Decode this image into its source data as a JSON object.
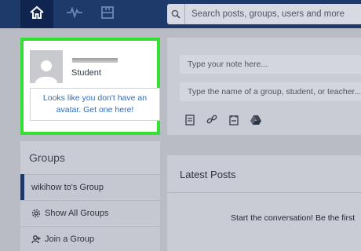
{
  "nav": {
    "search_placeholder": "Search posts, groups, users and more",
    "icons": [
      "home-icon",
      "activity-icon",
      "planner-icon",
      "search-icon"
    ]
  },
  "profile": {
    "role": "Student",
    "avatar_prompt": "Looks like you don't have an avatar. Get one here!"
  },
  "composer": {
    "note_placeholder": "Type your note here...",
    "recipient_placeholder": "Type the name of a group, student, or teacher..."
  },
  "groups": {
    "title": "Groups",
    "items": [
      {
        "label": "wikihow to's Group",
        "icon": ""
      },
      {
        "label": "Show All Groups",
        "icon": "gear-icon"
      },
      {
        "label": "Join a Group",
        "icon": "join-icon"
      }
    ]
  },
  "feed": {
    "title": "Latest Posts",
    "empty_message": "Start the conversation! Be the first"
  },
  "colors": {
    "topbar": "#1e3a6b",
    "highlight": "#35e035",
    "link": "#2d6cc0"
  }
}
